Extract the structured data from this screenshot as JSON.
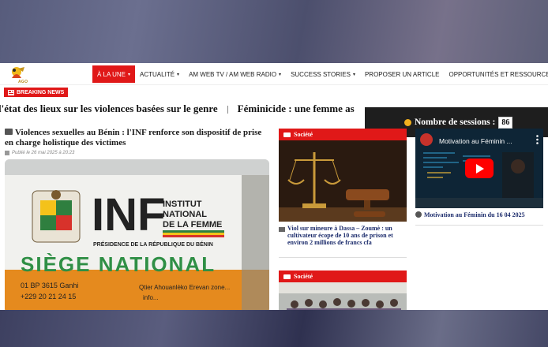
{
  "logo": {
    "text": "AGO COURE"
  },
  "nav": {
    "items": [
      {
        "label": "À LA UNE",
        "caret": "▾",
        "active": true
      },
      {
        "label": "ACTUALITÉ",
        "caret": "▾"
      },
      {
        "label": "AM WEB TV / AM WEB RADIO",
        "caret": "▾"
      },
      {
        "label": "SUCCESS STORIES",
        "caret": "▾"
      },
      {
        "label": "PROPOSER UN ARTICLE",
        "caret": ""
      },
      {
        "label": "OPPORTUNITÉS ET RESSOURCES",
        "caret": "▾"
      }
    ]
  },
  "breaking": {
    "label": "BREAKING NEWS",
    "ticker": [
      "l'état des lieux sur les violences basées sur le genre",
      "Féminicide : une femme as"
    ]
  },
  "sessions": {
    "label": "Nombre de sessions :",
    "count": "86"
  },
  "main_article": {
    "title": "Violences sexuelles au Bénin : l'INF renforce son dispositif de prise en charge holistique des victimes",
    "meta": "Publié le 26 mai 2025 à 20:23",
    "sign": {
      "inf": "INF",
      "line1": "INSTITUT",
      "line2": "NATIONAL",
      "line3": "DE LA FEMME",
      "presidence": "PRÉSIDENCE DE LA RÉPUBLIQUE DU BÉNIN",
      "siege": "SIÈGE NATIONAL",
      "bp": "01 BP 3615 Ganhi",
      "tel": "+229 20 21 24 15",
      "address": "Qtier Ahouanlèko Erevan zone...",
      "info": "info..."
    }
  },
  "middle": {
    "card1": {
      "category": "Société",
      "title": "Viol sur mineure à Dassa – Zoumè : un cultivateur écope de 10 ans de prison et environ 2 millions de francs cfa"
    },
    "card2": {
      "category": "Société"
    }
  },
  "right": {
    "video_title": "Motivation au Féminin ...",
    "caption": "Motivation au Féminin du 16 04 2025"
  },
  "colors": {
    "accent": "#e01818",
    "dark": "#1e1e1e",
    "link": "#1c2c6c"
  }
}
